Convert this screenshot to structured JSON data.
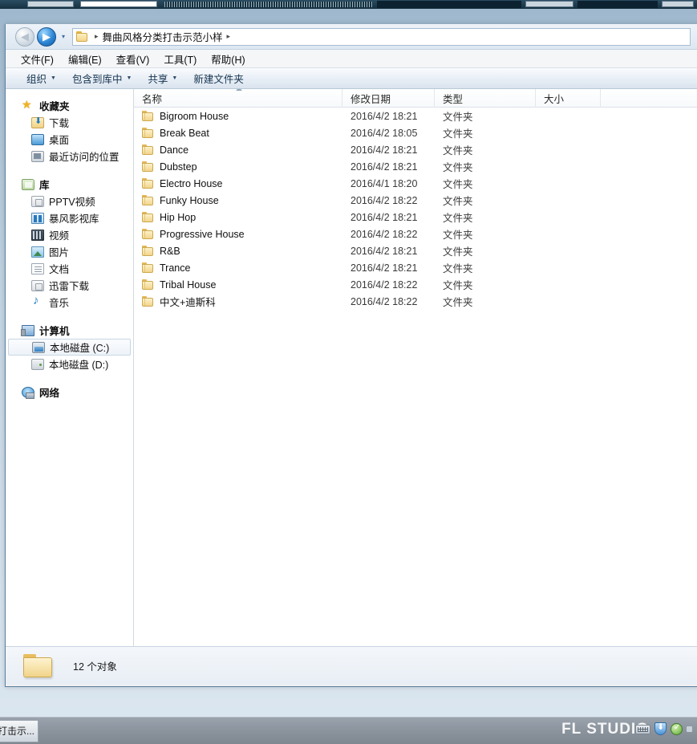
{
  "window": {
    "address": {
      "back_icon": "back-arrow-icon",
      "forward_icon": "forward-arrow-icon",
      "history_caret": "▾",
      "folder_icon": "folder-icon",
      "separator": "▸",
      "path_segment": "舞曲风格分类打击示范小样"
    },
    "menu": [
      {
        "label": "文件(F)"
      },
      {
        "label": "编辑(E)"
      },
      {
        "label": "查看(V)"
      },
      {
        "label": "工具(T)"
      },
      {
        "label": "帮助(H)"
      }
    ],
    "toolbar": [
      {
        "label": "组织",
        "caret": "▼"
      },
      {
        "label": "包含到库中",
        "caret": "▼"
      },
      {
        "label": "共享",
        "caret": "▼"
      },
      {
        "label": "新建文件夹",
        "caret": ""
      }
    ]
  },
  "sidebar": {
    "groups": [
      {
        "header": {
          "label": "收藏夹",
          "icon": "star-icon"
        },
        "items": [
          {
            "label": "下载",
            "icon": "download-folder-icon"
          },
          {
            "label": "桌面",
            "icon": "desktop-icon"
          },
          {
            "label": "最近访问的位置",
            "icon": "recent-places-icon"
          }
        ]
      },
      {
        "header": {
          "label": "库",
          "icon": "library-icon"
        },
        "items": [
          {
            "label": "PPTV视频",
            "icon": "pptv-video-icon"
          },
          {
            "label": "暴风影视库",
            "icon": "baofeng-library-icon"
          },
          {
            "label": "视频",
            "icon": "video-icon"
          },
          {
            "label": "图片",
            "icon": "pictures-icon"
          },
          {
            "label": "文档",
            "icon": "documents-icon"
          },
          {
            "label": "迅雷下载",
            "icon": "thunder-download-icon"
          },
          {
            "label": "音乐",
            "icon": "music-icon"
          }
        ]
      },
      {
        "header": {
          "label": "计算机",
          "icon": "computer-icon"
        },
        "items": [
          {
            "label": "本地磁盘 (C:)",
            "icon": "hard-disk-c-icon",
            "selected": true
          },
          {
            "label": "本地磁盘 (D:)",
            "icon": "hard-disk-d-icon",
            "selected": false
          }
        ]
      },
      {
        "header": {
          "label": "网络",
          "icon": "network-icon"
        },
        "items": []
      }
    ]
  },
  "filelist": {
    "columns": [
      {
        "key": "name",
        "label": "名称",
        "sorted": "asc"
      },
      {
        "key": "date",
        "label": "修改日期"
      },
      {
        "key": "type",
        "label": "类型"
      },
      {
        "key": "size",
        "label": "大小"
      }
    ],
    "rows": [
      {
        "name": "Bigroom House",
        "date": "2016/4/2 18:21",
        "type": "文件夹",
        "size": ""
      },
      {
        "name": "Break Beat",
        "date": "2016/4/2 18:05",
        "type": "文件夹",
        "size": ""
      },
      {
        "name": "Dance",
        "date": "2016/4/2 18:21",
        "type": "文件夹",
        "size": ""
      },
      {
        "name": "Dubstep",
        "date": "2016/4/2 18:21",
        "type": "文件夹",
        "size": ""
      },
      {
        "name": "Electro House",
        "date": "2016/4/1 18:20",
        "type": "文件夹",
        "size": ""
      },
      {
        "name": "Funky House",
        "date": "2016/4/2 18:22",
        "type": "文件夹",
        "size": ""
      },
      {
        "name": "Hip Hop",
        "date": "2016/4/2 18:21",
        "type": "文件夹",
        "size": ""
      },
      {
        "name": "Progressive House",
        "date": "2016/4/2 18:22",
        "type": "文件夹",
        "size": ""
      },
      {
        "name": "R&B",
        "date": "2016/4/2 18:21",
        "type": "文件夹",
        "size": ""
      },
      {
        "name": "Trance",
        "date": "2016/4/2 18:21",
        "type": "文件夹",
        "size": ""
      },
      {
        "name": "Tribal House",
        "date": "2016/4/2 18:22",
        "type": "文件夹",
        "size": ""
      },
      {
        "name": "中文+迪斯科",
        "date": "2016/4/2 18:22",
        "type": "文件夹",
        "size": ""
      }
    ]
  },
  "statusbar": {
    "icon": "folder-large-icon",
    "text": "12 个对象"
  },
  "taskbar": {
    "button_label": "打击示...",
    "watermark": "FL STUDIO",
    "tray": [
      {
        "icon": "keyboard-layout-icon"
      },
      {
        "icon": "shield-update-icon"
      },
      {
        "icon": "green-check-icon"
      }
    ]
  },
  "colors": {
    "folder_yellow": "#f2d58c",
    "accent_blue": "#2c87d6",
    "taskbar_grey": "#8b939d"
  }
}
